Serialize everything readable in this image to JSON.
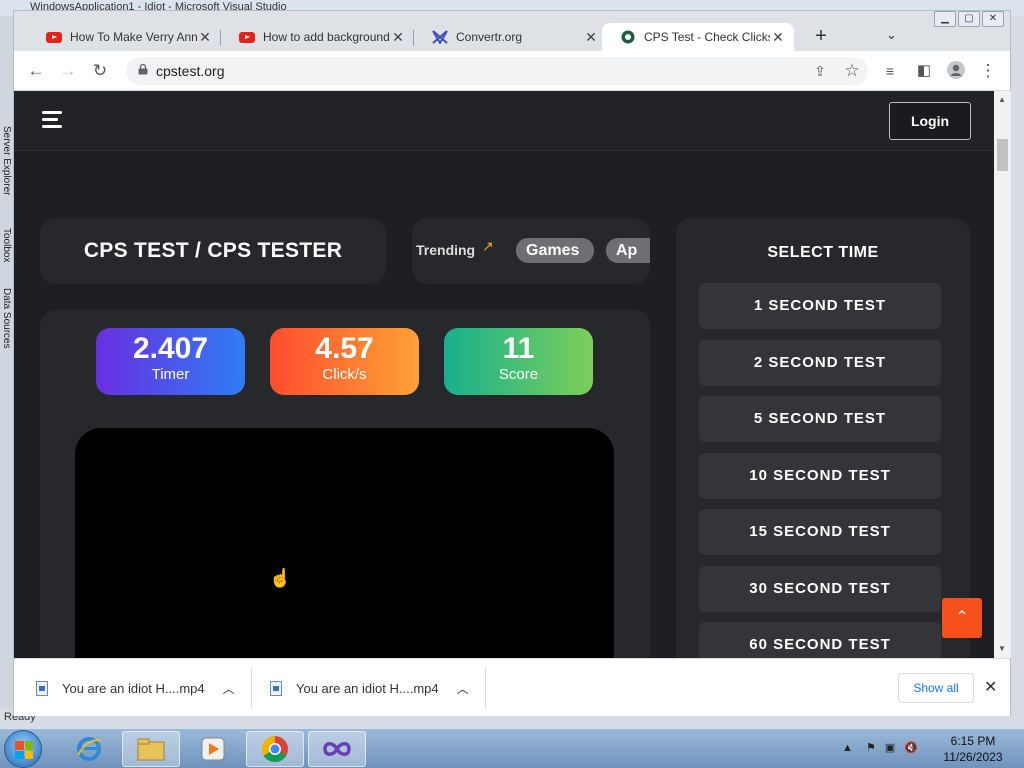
{
  "vs": {
    "title": "WindowsApplication1 - Idiot - Microsoft Visual Studio",
    "side_labels": [
      "Server Explorer",
      "Toolbox",
      "Data Sources"
    ],
    "status": "Ready"
  },
  "browser": {
    "tabs": [
      {
        "title": "How To Make Verry Annoying Program",
        "icon": "youtube-icon"
      },
      {
        "title": "How to add background music",
        "icon": "youtube-icon"
      },
      {
        "title": "Convertr.org",
        "icon": "convertr-icon"
      },
      {
        "title": "CPS Test - Check Clicks per Second",
        "icon": "cpstest-icon",
        "active": true
      }
    ],
    "new_tab": "+",
    "url": "cpstest.org"
  },
  "site": {
    "login": "Login",
    "title": "CPS TEST / CPS TESTER",
    "trending_label": "Trending",
    "trending_chips": [
      "Games",
      "Ap"
    ],
    "stats": {
      "timer_value": "2.407",
      "timer_label": "Timer",
      "cps_value": "4.57",
      "cps_label": "Click/s",
      "score_value": "11",
      "score_label": "Score"
    },
    "select_time": "SELECT TIME",
    "time_options": [
      "1 SECOND TEST",
      "2 SECOND TEST",
      "5 SECOND TEST",
      "10 SECOND TEST",
      "15 SECOND TEST",
      "30 SECOND TEST",
      "60 SECOND TEST"
    ],
    "colors": {
      "accent": "#f6511d",
      "background": "#1e1f23",
      "card": "#27282c"
    }
  },
  "downloads": {
    "items": [
      "You are an idiot H....mp4",
      "You are an idiot H....mp4"
    ],
    "show_all": "Show all"
  },
  "taskbar": {
    "time": "6:15 PM",
    "date": "11/26/2023"
  }
}
